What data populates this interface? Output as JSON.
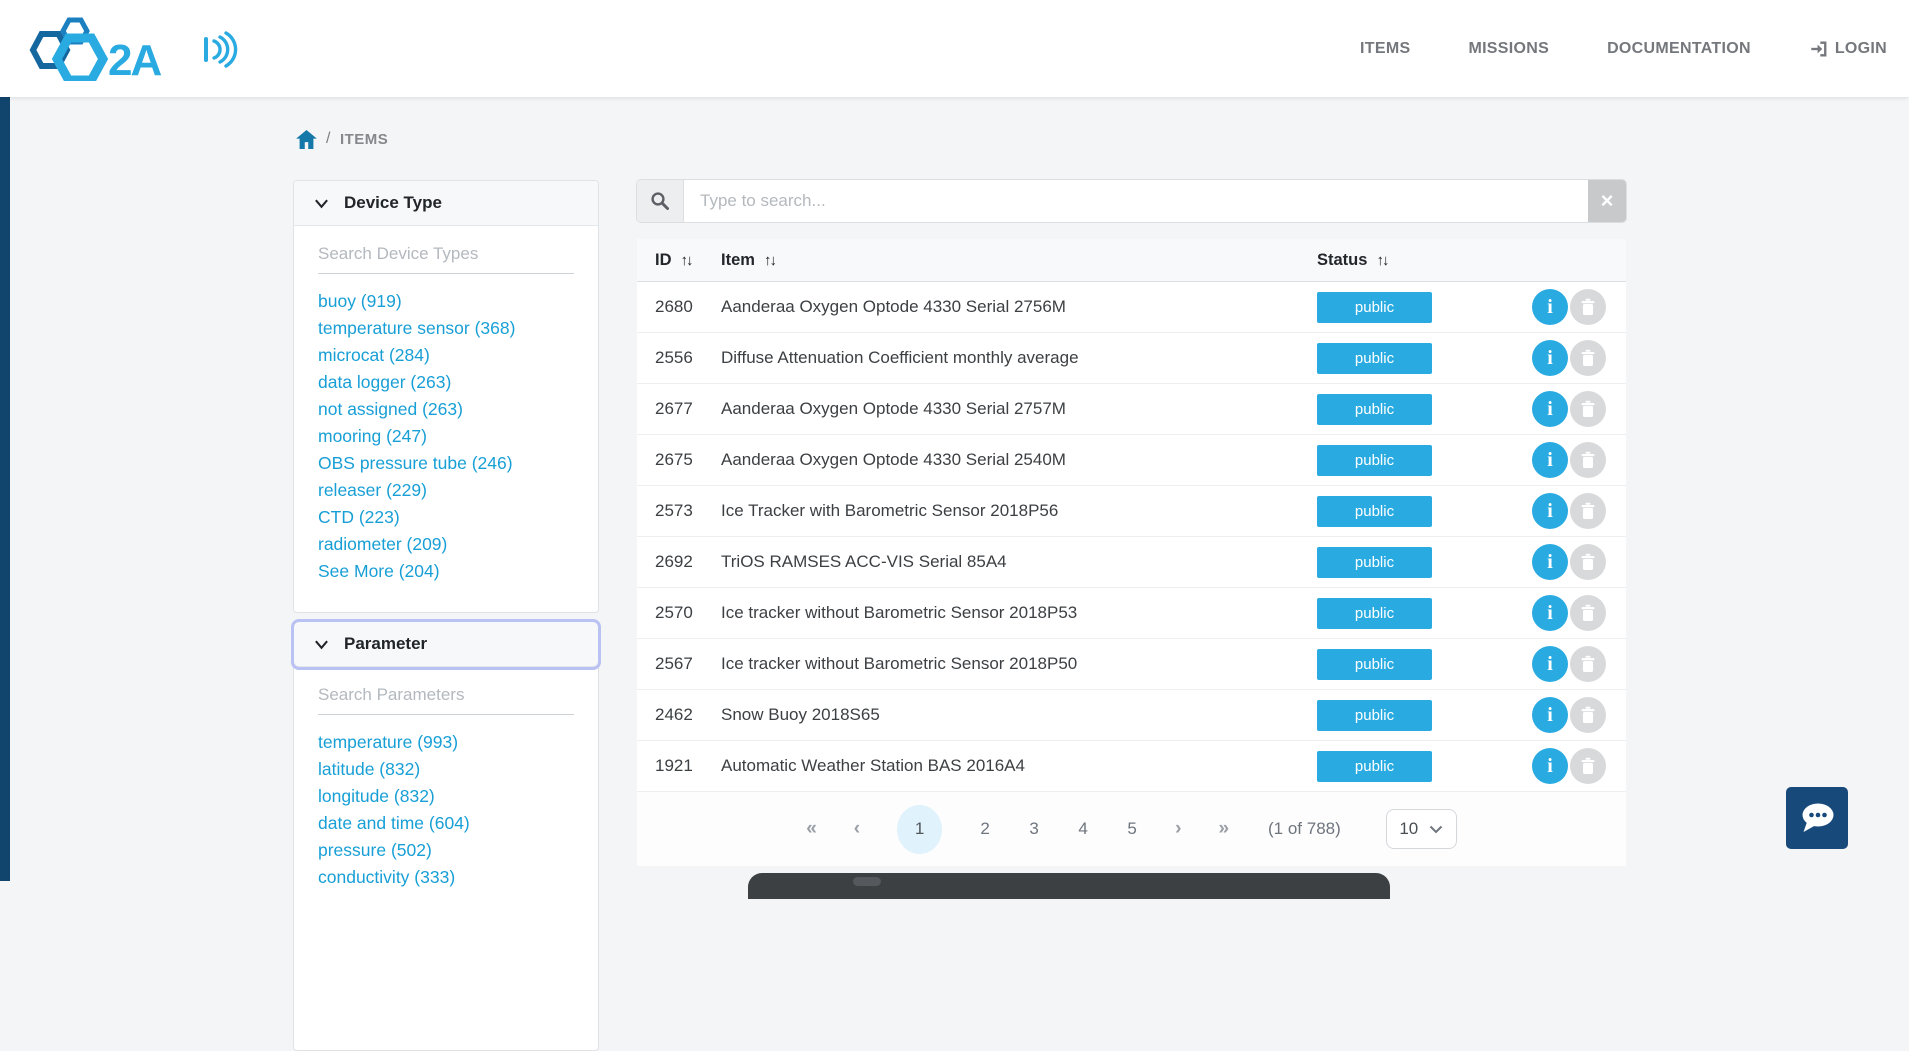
{
  "header": {
    "logo_text": "2A",
    "nav": [
      {
        "label": "ITEMS"
      },
      {
        "label": "MISSIONS"
      },
      {
        "label": "DOCUMENTATION"
      },
      {
        "label": "LOGIN"
      }
    ]
  },
  "breadcrumb": {
    "separator": "/",
    "current": "ITEMS"
  },
  "filters": {
    "device_type": {
      "title": "Device Type",
      "search_placeholder": "Search Device Types",
      "items": [
        "buoy (919)",
        "temperature sensor (368)",
        "microcat (284)",
        "data logger (263)",
        "not assigned (263)",
        "mooring (247)",
        "OBS pressure tube (246)",
        "releaser (229)",
        "CTD (223)",
        "radiometer (209)"
      ],
      "see_more": "See More (204)"
    },
    "parameter": {
      "title": "Parameter",
      "search_placeholder": "Search Parameters",
      "items": [
        "temperature (993)",
        "latitude (832)",
        "longitude (832)",
        "date and time (604)",
        "pressure (502)",
        "conductivity (333)"
      ]
    }
  },
  "search": {
    "placeholder": "Type to search...",
    "clear_glyph": "×"
  },
  "table": {
    "columns": [
      {
        "label": "ID"
      },
      {
        "label": "Item"
      },
      {
        "label": "Status"
      }
    ],
    "sort_glyph": "↑↓",
    "info_glyph": "i",
    "rows": [
      {
        "id": "2680",
        "item": "Aanderaa Oxygen Optode 4330 Serial 2756M",
        "status": "public"
      },
      {
        "id": "2556",
        "item": "Diffuse Attenuation Coefficient monthly average",
        "status": "public"
      },
      {
        "id": "2677",
        "item": "Aanderaa Oxygen Optode 4330 Serial 2757M",
        "status": "public"
      },
      {
        "id": "2675",
        "item": "Aanderaa Oxygen Optode 4330 Serial 2540M",
        "status": "public"
      },
      {
        "id": "2573",
        "item": "Ice Tracker with Barometric Sensor 2018P56",
        "status": "public"
      },
      {
        "id": "2692",
        "item": "TriOS RAMSES ACC-VIS Serial 85A4",
        "status": "public"
      },
      {
        "id": "2570",
        "item": "Ice tracker without Barometric Sensor 2018P53",
        "status": "public"
      },
      {
        "id": "2567",
        "item": "Ice tracker without Barometric Sensor 2018P50",
        "status": "public"
      },
      {
        "id": "2462",
        "item": "Snow Buoy 2018S65",
        "status": "public"
      },
      {
        "id": "1921",
        "item": "Automatic Weather Station BAS 2016A4",
        "status": "public"
      }
    ]
  },
  "pagination": {
    "first": "«",
    "prev": "‹",
    "pages": [
      "1",
      "2",
      "3",
      "4",
      "5"
    ],
    "active_page": "1",
    "next": "›",
    "last": "»",
    "summary": "(1 of 788)",
    "page_size": "10"
  },
  "colors": {
    "accent_blue": "#29abe2",
    "link_blue": "#189fd6",
    "navy_strip": "#11456d",
    "chat_navy": "#17497b",
    "nav_gray": "#74777b",
    "focus_ring": "#bac1f3",
    "badge_text": "#ffffff"
  }
}
